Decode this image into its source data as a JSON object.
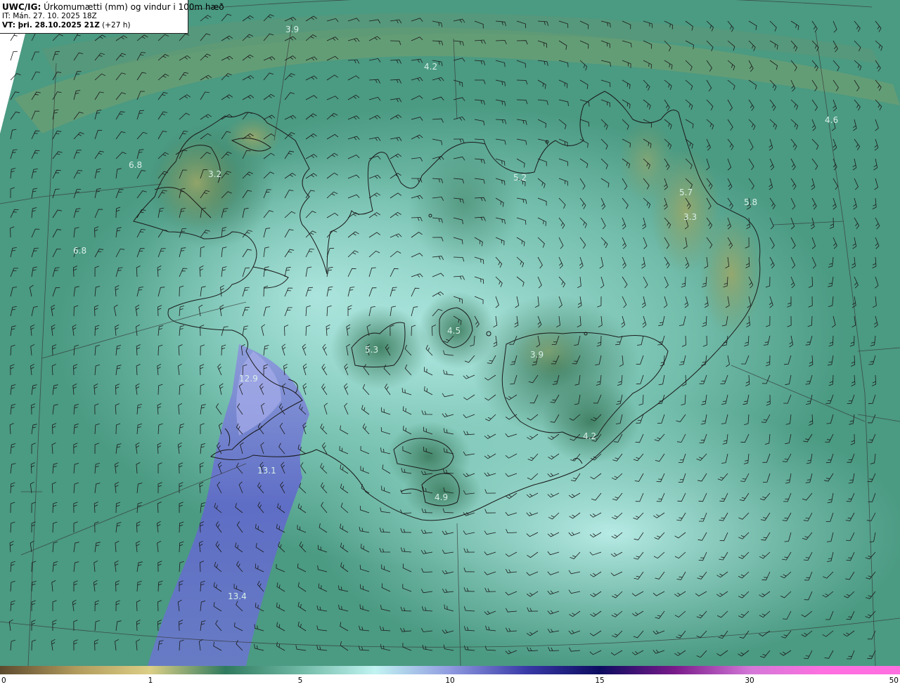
{
  "header": {
    "product_bold": "UWC/IG:",
    "product_rest": " Úrkomumætti (mm) og vindur i 100m hæð",
    "init_time": "IT: Mán. 27. 10. 2025 18Z",
    "valid_label": "VT: þri. 28.10.2025 21Z",
    "valid_offset": " (+27 h)"
  },
  "map": {
    "value_labels": [
      {
        "text": "3.9"
      },
      {
        "text": "4.2"
      },
      {
        "text": "4.6"
      },
      {
        "text": "6.8"
      },
      {
        "text": "3.2"
      },
      {
        "text": "5.2"
      },
      {
        "text": "5.7"
      },
      {
        "text": "5.8"
      },
      {
        "text": "3.3"
      },
      {
        "text": "6.8"
      },
      {
        "text": "4.5"
      },
      {
        "text": "5.3"
      },
      {
        "text": "3.9"
      },
      {
        "text": "12.9"
      },
      {
        "text": "4.2"
      },
      {
        "text": "13.1"
      },
      {
        "text": "4.9"
      },
      {
        "text": "13.4"
      }
    ],
    "colors": {
      "sea_base": "#4a9b83",
      "land_dark": "#3d8a72",
      "highlight_light": "#b6eeea",
      "precip_blue": "#5f6bc8",
      "ridge_olive": "#8ea26a"
    }
  },
  "colorbar": {
    "ticks": [
      {
        "label": "0"
      },
      {
        "label": "1"
      },
      {
        "label": "5"
      },
      {
        "label": "10"
      },
      {
        "label": "15"
      },
      {
        "label": "30"
      },
      {
        "label": "50"
      }
    ],
    "stops": [
      "#5c4a2e",
      "#b09a5c",
      "#dccf86",
      "#2f7a5e",
      "#6fb9a5",
      "#c2f4f2",
      "#8f9ae0",
      "#3a3aa8",
      "#0c0c60",
      "#7a1a8a",
      "#d478d8",
      "#ff6fe0"
    ]
  }
}
